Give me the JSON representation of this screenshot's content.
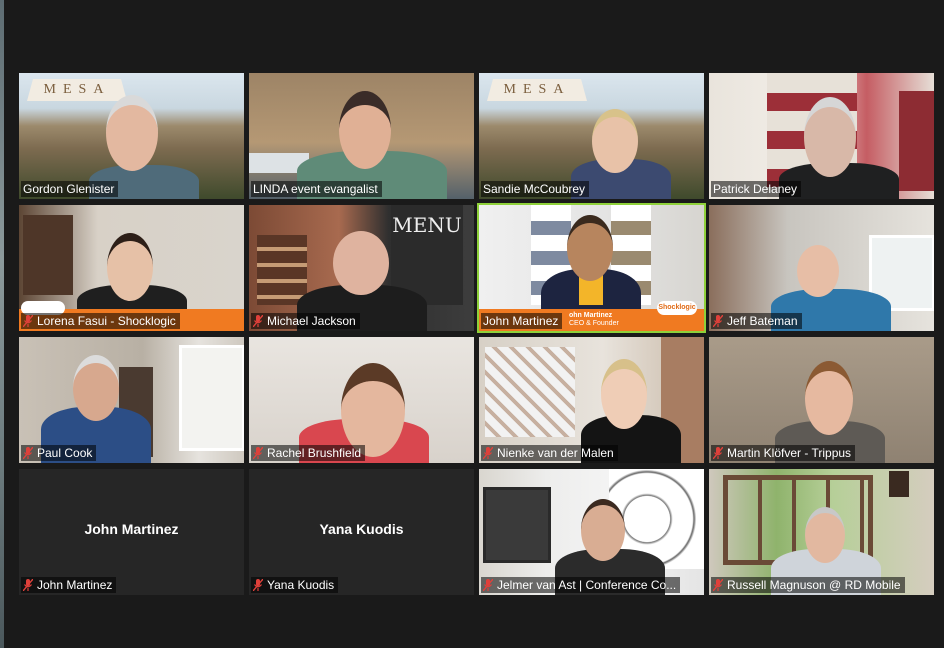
{
  "participants": [
    {
      "name": "Gordon Glenister",
      "logo": "MESA",
      "muted": false
    },
    {
      "name": "LINDA event evangalist",
      "muted": false
    },
    {
      "name": "Sandie McCoubrey",
      "logo": "MESA",
      "muted": false
    },
    {
      "name": "Patrick Delaney",
      "muted": false
    },
    {
      "name": "Lorena Fasui - Shocklogic",
      "muted": true
    },
    {
      "name": "Michael Jackson",
      "muted": true,
      "sign": "MENU"
    },
    {
      "name": "John Martinez",
      "muted": false,
      "active_speaker": true,
      "banner_name": "ohn Martinez",
      "banner_title": "CEO & Founder",
      "banner_logo": "Shocklogic"
    },
    {
      "name": "Jeff Bateman",
      "muted": true
    },
    {
      "name": "Paul Cook",
      "muted": true
    },
    {
      "name": "Rachel Brushfield",
      "muted": true
    },
    {
      "name": "Nienke van der Malen",
      "muted": true
    },
    {
      "name": "Martin Klöfver - Trippus",
      "muted": true
    },
    {
      "name": "John Martinez",
      "muted": true,
      "video_off": true,
      "display_name": "John Martinez"
    },
    {
      "name": "Yana Kuodis",
      "muted": true,
      "video_off": true,
      "display_name": "Yana Kuodis"
    },
    {
      "name": "Jelmer van Ast | Conference Co...",
      "muted": true
    },
    {
      "name": "Russell Magnuson @ RD Mobile",
      "muted": true
    }
  ],
  "colors": {
    "active_speaker_border": "#8fd13a",
    "muted_mic": "#e0403a",
    "banner": "#f07a21"
  }
}
